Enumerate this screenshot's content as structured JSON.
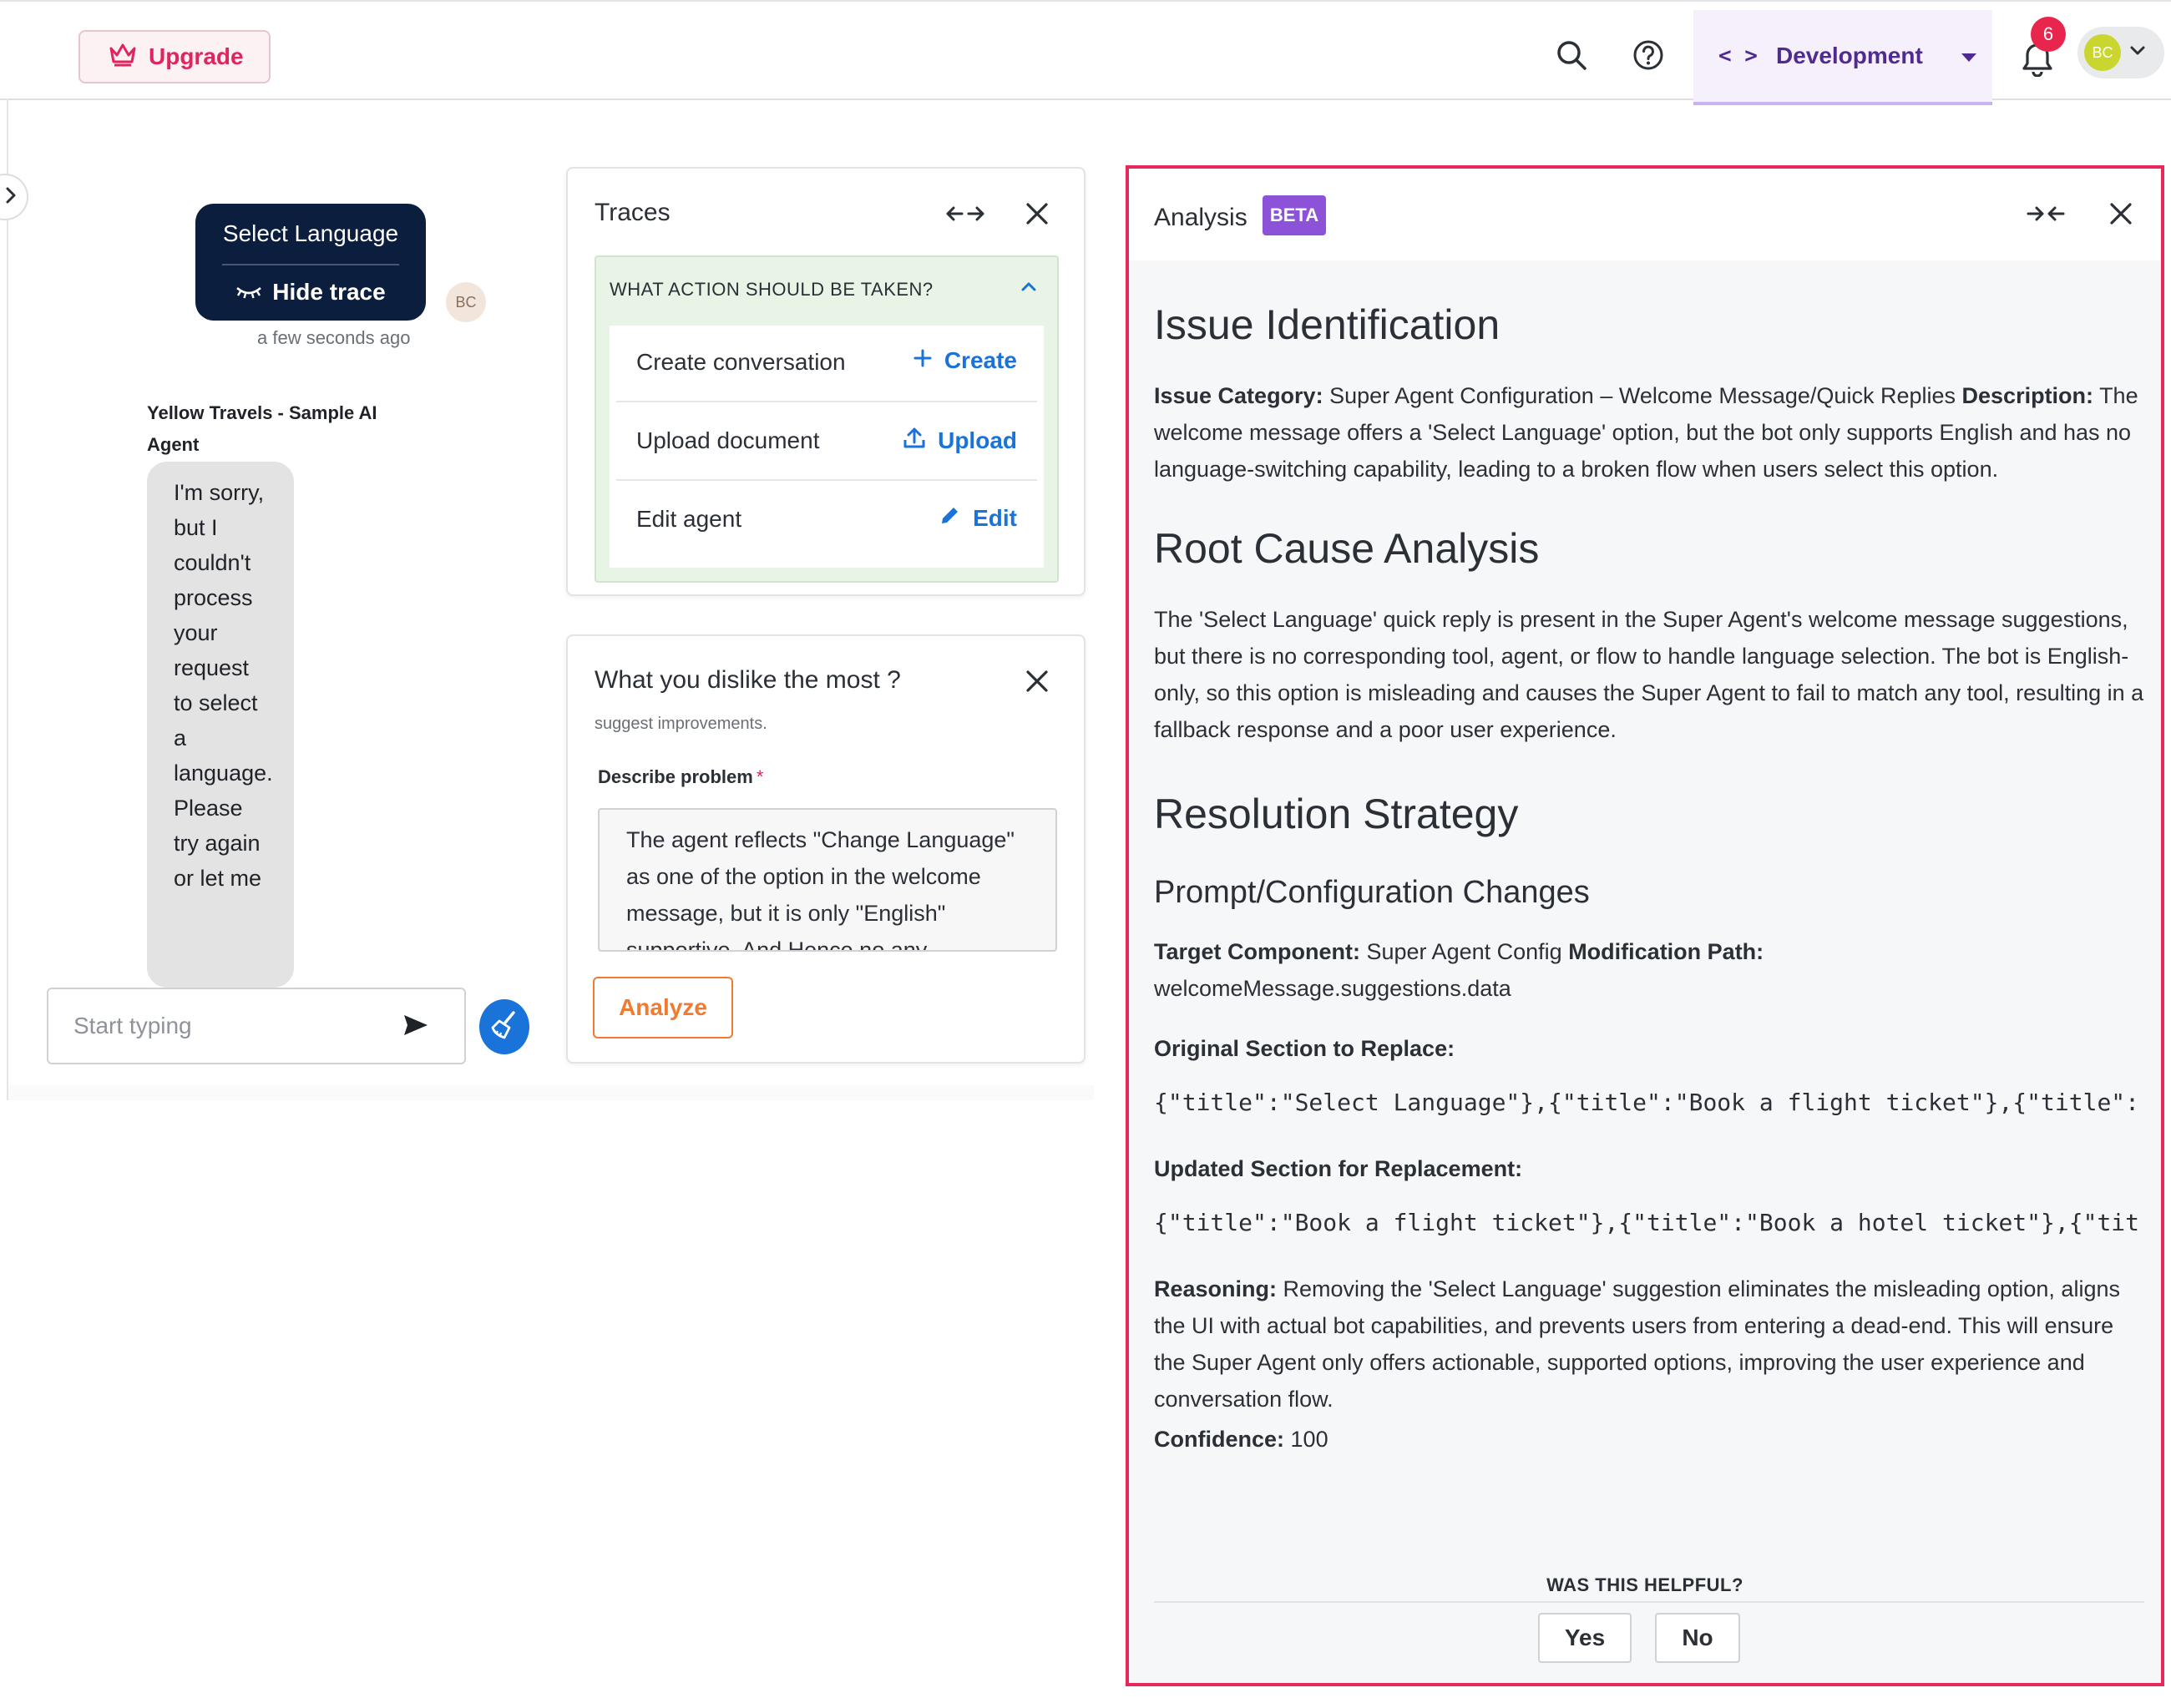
{
  "header": {
    "upgrade_label": "Upgrade",
    "environment_label": "Development",
    "notification_count": "6",
    "user_initials": "BC"
  },
  "chat": {
    "user_message": "Select Language",
    "hide_trace_label": "Hide trace",
    "user_avatar_initials": "BC",
    "timestamp": "a few seconds ago",
    "agent_name": "Yellow Travels - Sample AI Agent",
    "bot_message": "I'm sorry, but I couldn't process your request to select a language. Please try again or let me",
    "composer_placeholder": "Start typing"
  },
  "traces": {
    "title": "Traces",
    "section_title": "WHAT ACTION SHOULD BE TAKEN?",
    "actions": [
      {
        "label": "Create conversation",
        "action": "Create",
        "icon": "plus-icon"
      },
      {
        "label": "Upload document",
        "action": "Upload",
        "icon": "upload-icon"
      },
      {
        "label": "Edit agent",
        "action": "Edit",
        "icon": "pencil-icon"
      }
    ]
  },
  "feedback": {
    "title": "What you dislike the most ?",
    "subtitle": "suggest improvements.",
    "field_label": "Describe problem",
    "required_mark": "*",
    "text": "The agent reflects \"Change Language\" as one of the option in the welcome message, but it is only \"English\" supportive. And Hence no any",
    "analyze_label": "Analyze"
  },
  "analysis": {
    "title": "Analysis",
    "badge": "BETA",
    "issue_heading": "Issue Identification",
    "issue_category_label": "Issue Category:",
    "issue_category_value": "Super Agent Configuration – Welcome Message/Quick Replies",
    "description_label": "Description:",
    "description_value": "The welcome message offers a 'Select Language' option, but the bot only supports English and has no language-switching capability, leading to a broken flow when users select this option.",
    "root_cause_heading": "Root Cause Analysis",
    "root_cause_text": "The 'Select Language' quick reply is present in the Super Agent's welcome message suggestions, but there is no corresponding tool, agent, or flow to handle language selection. The bot is English-only, so this option is misleading and causes the Super Agent to fail to match any tool, resulting in a fallback response and a poor user experience.",
    "resolution_heading": "Resolution Strategy",
    "changes_heading": "Prompt/Configuration Changes",
    "target_component_label": "Target Component:",
    "target_component_value": "Super Agent Config",
    "modification_path_label": "Modification Path:",
    "modification_path_value": "welcomeMessage.suggestions.data",
    "original_label": "Original Section to Replace:",
    "original_code": "{\"title\":\"Select Language\"},{\"title\":\"Book a flight ticket\"},{\"title\":",
    "updated_label": "Updated Section for Replacement:",
    "updated_code": "{\"title\":\"Book a flight ticket\"},{\"title\":\"Book a hotel ticket\"},{\"tit",
    "reasoning_label": "Reasoning:",
    "reasoning_value": "Removing the 'Select Language' suggestion eliminates the misleading option, aligns the UI with actual bot capabilities, and prevents users from entering a dead-end. This will ensure the Super Agent only offers actionable, supported options, improving the user experience and conversation flow.",
    "confidence_label": "Confidence:",
    "confidence_value": "100",
    "helpful_question": "WAS THIS HELPFUL?",
    "yes_label": "Yes",
    "no_label": "No"
  },
  "colors": {
    "accent_pink": "#e0245e",
    "panel_border": "#e8275c",
    "environment_purple": "#4f2b91",
    "link_blue": "#1a73d9",
    "analyze_orange": "#f07a30",
    "beta_purple": "#8c53d9",
    "bubble_navy": "#0c1e3d"
  }
}
